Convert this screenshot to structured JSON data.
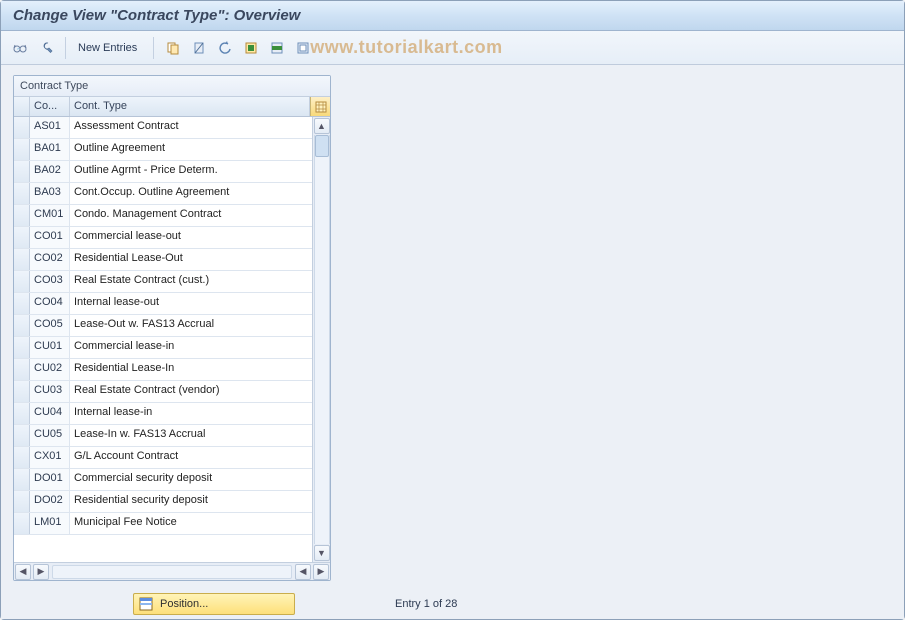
{
  "title": "Change View \"Contract Type\": Overview",
  "watermark": "www.tutorialkart.com",
  "toolbar": {
    "new_entries_label": "New Entries"
  },
  "grid": {
    "title": "Contract Type",
    "col1_header": "Co...",
    "col2_header": "Cont. Type",
    "rows": [
      {
        "code": "AS01",
        "desc": "Assessment Contract"
      },
      {
        "code": "BA01",
        "desc": "Outline Agreement"
      },
      {
        "code": "BA02",
        "desc": "Outline Agrmt - Price Determ."
      },
      {
        "code": "BA03",
        "desc": "Cont.Occup. Outline Agreement"
      },
      {
        "code": "CM01",
        "desc": "Condo. Management Contract"
      },
      {
        "code": "CO01",
        "desc": "Commercial lease-out"
      },
      {
        "code": "CO02",
        "desc": "Residential Lease-Out"
      },
      {
        "code": "CO03",
        "desc": "Real Estate Contract (cust.)"
      },
      {
        "code": "CO04",
        "desc": "Internal lease-out"
      },
      {
        "code": "CO05",
        "desc": "Lease-Out w. FAS13 Accrual"
      },
      {
        "code": "CU01",
        "desc": "Commercial lease-in"
      },
      {
        "code": "CU02",
        "desc": "Residential Lease-In"
      },
      {
        "code": "CU03",
        "desc": "Real Estate Contract (vendor)"
      },
      {
        "code": "CU04",
        "desc": "Internal lease-in"
      },
      {
        "code": "CU05",
        "desc": "Lease-In w. FAS13 Accrual"
      },
      {
        "code": "CX01",
        "desc": "G/L Account Contract"
      },
      {
        "code": "DO01",
        "desc": "Commercial security deposit"
      },
      {
        "code": "DO02",
        "desc": "Residential security deposit"
      },
      {
        "code": "LM01",
        "desc": "Municipal Fee Notice"
      }
    ]
  },
  "footer": {
    "position_label": "Position...",
    "entry_text": "Entry 1 of 28"
  },
  "colors": {
    "accent": "#cfe2f5",
    "warn_bg": "#fde07a"
  }
}
